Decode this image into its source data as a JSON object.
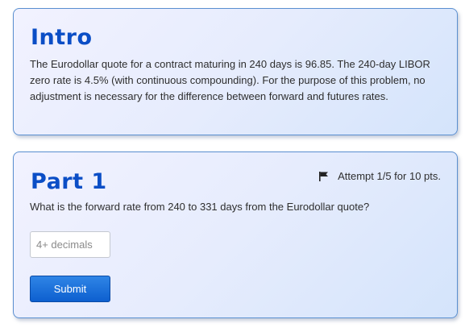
{
  "intro": {
    "title": "Intro",
    "text": "The Eurodollar quote for a contract maturing in 240 days is 96.85. The 240-day LIBOR zero rate is 4.5% (with continuous compounding). For the purpose of this problem, no adjustment is necessary for the difference between forward and futures rates."
  },
  "part1": {
    "title": "Part 1",
    "attempt_icon": "flag-icon",
    "attempt_text": "Attempt 1/5 for 10 pts.",
    "question": "What is the forward rate from 240 to 331 days from the Eurodollar quote?",
    "answer": {
      "value": "",
      "placeholder": "4+ decimals"
    },
    "submit_label": "Submit"
  },
  "colors": {
    "title": "#0b4ec6",
    "card_border": "#5a8fd0",
    "button": "#0d5fcf"
  }
}
